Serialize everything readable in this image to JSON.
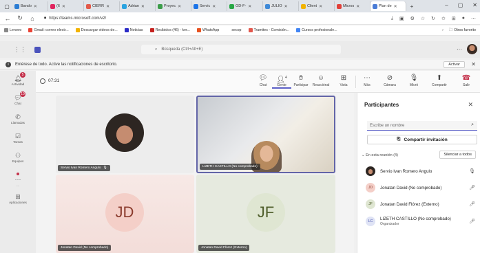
{
  "browser": {
    "tabs": [
      {
        "label": "Bando",
        "color": "#2b7cd3"
      },
      {
        "label": "(6",
        "color": "#e0245e"
      },
      {
        "label": "CIERR",
        "color": "#e25a4a"
      },
      {
        "label": "Adrian",
        "color": "#2aa3e0"
      },
      {
        "label": "Proyec",
        "color": "#3c9d4a"
      },
      {
        "label": "Servic",
        "color": "#1a73e8"
      },
      {
        "label": "GD-F-",
        "color": "#28a745"
      },
      {
        "label": "JULIO",
        "color": "#3f8ad8"
      },
      {
        "label": "Client",
        "color": "#f2b300"
      },
      {
        "label": "Micros",
        "color": "#e2413a"
      },
      {
        "label": "Plan de",
        "color": "#4a7cd6",
        "active": true
      }
    ],
    "new_tab": "+",
    "url": "https://teams.microsoft.com/v2/",
    "bookmarks": [
      {
        "label": "Lenovo",
        "color": "#888888"
      },
      {
        "label": "Gmail: correo electr...",
        "color": "#ea4335"
      },
      {
        "label": "Descargar videos de...",
        "color": "#f2b300"
      },
      {
        "label": "Noticias",
        "color": "#2b2bc7"
      },
      {
        "label": "Recibidos (46) - ker...",
        "color": "#c5221f"
      },
      {
        "label": "WhatsApp",
        "color": "#e8521f"
      },
      {
        "label": "secop",
        "color": "#ffffff"
      },
      {
        "label": "Tramites - Comisión...",
        "color": "#e2574c"
      },
      {
        "label": "Cursos profesionale...",
        "color": "#4285f4"
      }
    ],
    "other_favorites": "Otros favorito"
  },
  "teams": {
    "search_placeholder": "Búsqueda (Ctrl+Alt+E)",
    "notification_text": "Entérese de todo. Active las notificaciones de escritorio.",
    "activate_label": "Activar",
    "rail": [
      {
        "label": "Actividad",
        "icon": "bell-icon",
        "badge": "5"
      },
      {
        "label": "Chat",
        "icon": "chat-icon",
        "badge": "10"
      },
      {
        "label": "Llamadas",
        "icon": "phone-icon"
      },
      {
        "label": "Tareas",
        "icon": "tasks-icon"
      },
      {
        "label": "Equipos",
        "icon": "teams-icon"
      },
      {
        "label": "...",
        "icon": "more-icon"
      },
      {
        "label": "Aplicaciones",
        "icon": "apps-icon"
      }
    ],
    "timer": "07:31",
    "toolbar": {
      "chat": "Chat",
      "people": "Gente",
      "people_count": "4",
      "raise": "Participar",
      "react": "Reacciónal",
      "view": "Vista",
      "more": "Más",
      "camera": "Cámara",
      "mic": "Micró",
      "share": "Compartir",
      "leave": "Salir"
    },
    "tiles": [
      {
        "name": "Servio Ivan Romero Angulo"
      },
      {
        "name": "LIZETH CASTILLO (No comprobado)"
      },
      {
        "name": "Jonatan David (No comprobado)",
        "initials": "JD"
      },
      {
        "name": "Jonatan David Flórez (Externo)",
        "initials": "JF"
      }
    ],
    "participants": {
      "title": "Participantes",
      "search_placeholder": "Escribe un nombre",
      "share_invite": "Compartir invitación",
      "in_meeting": "En esta reunión (4)",
      "mute_all": "Silenciar a todos",
      "list": [
        {
          "name": "Servio Ivan Romero Angulo",
          "avatar": "photo"
        },
        {
          "name": "Jonatan David (No comprobado)",
          "avatar": "JD",
          "bg": "#f4cfc8",
          "fg": "#8a3a2c"
        },
        {
          "name": "Jonatan David Flórez (Externo)",
          "avatar": "JF",
          "bg": "#dfe6d2",
          "fg": "#4e5d2a"
        },
        {
          "name": "LIZETH CASTILLO (No comprobado)",
          "role": "Organizador",
          "avatar": "LC",
          "bg": "#dfe3f5",
          "fg": "#3d4aa8"
        }
      ]
    }
  }
}
